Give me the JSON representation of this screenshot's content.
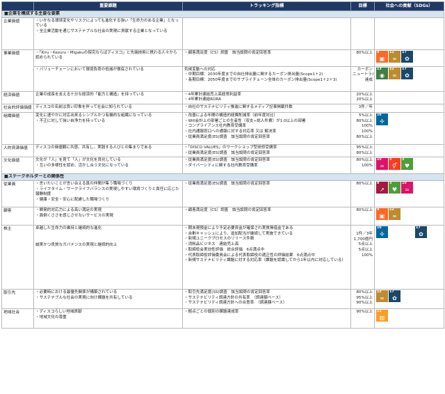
{
  "header": {
    "col_issue": "重要課題",
    "col_tracking": "トラッキング指標",
    "col_target": "目標",
    "col_sdgs": "社会への貢献（SDGs）"
  },
  "colors": {
    "header_bg": "#1f3864",
    "section_bg": "#d6e4f0"
  },
  "sdg_colors": {
    "3": "#4c9f38",
    "5": "#ff3a21",
    "8": "#a21942",
    "9": "#fd6925",
    "10": "#dd1367",
    "11": "#fd9d24",
    "12": "#bf8b2e",
    "13": "#3f7e44",
    "16": "#00689d",
    "17": "#19486a"
  },
  "sdg_icons": {
    "3": "heartbeat-icon",
    "5": "gender-equality-icon",
    "8": "growth-chart-icon",
    "9": "cubes-icon",
    "10": "equality-icon",
    "11": "buildings-icon",
    "12": "infinity-loop-icon",
    "13": "eye-globe-icon",
    "16": "dove-icon",
    "17": "flower-rings-icon"
  },
  "sections": [
    {
      "title": "■企業を構成する主要な要素",
      "rows": [
        {
          "cat": "企業価値",
          "issue": [
            "・いかなる環境変化やリスクによっても進化する強い「生命力のある企業」となっている",
            "・全企業活動を通じサステナブルな社会の実現に貢献する企業となっている"
          ],
          "track": [],
          "tgt": [],
          "sdgs": []
        },
        {
          "cat": "事業価値",
          "issue": [
            "・「Kiru・Kezuru・Migakuの探究ならばディスコ」と先端技術に携わる人々から認められている"
          ],
          "track": [
            "・顧客満足度（CS）調査　該当設問の肯定回答率"
          ],
          "tgt": [
            "80%以上"
          ],
          "sdgs": [
            "9",
            "12",
            "17"
          ]
        },
        {
          "cat": "",
          "issue": [
            "・バリューチェーンにおいて環境負荷の低減が徹底されている"
          ],
          "track": [
            "気候変動への対応",
            "・中期目標：2030年度までの自社排出量に関するカーボン排出量(Scope1＋2)",
            "・長期目標：2050年度までのサプライチェーン全体のカーボン排出量(Scope1＋2＋3)"
          ],
          "tgt": [
            "カーボン",
            "ニュートラル",
            "達成"
          ],
          "sdgs": [
            "13",
            "12",
            "17"
          ]
        },
        {
          "cat": "経済価値",
          "issue": [
            "企業の成長を支える十分な経済的「能力と構造」を持っている"
          ],
          "track": [
            "・4年累計連結売上高経常利益率",
            "・4年累計連結RORA"
          ],
          "tgt": [
            "20%以上",
            "20%以上"
          ],
          "sdgs": []
        },
        {
          "cat": "社会的評価価値",
          "issue": [
            "ディスコの名前は良い印象を伴って社会に知られている"
          ],
          "track": [
            "・自社のサステナビリティ推進に関するメディア記事掲載件数"
          ],
          "tgt": [
            "3件／年"
          ],
          "sdgs": []
        },
        {
          "cat": "組織価値",
          "issue": [
            "変化に速やかに対応出来るシンプルかつ有機的な組織になっている",
            "・不正に対して強い自浄力を持っている"
          ],
          "track": [
            "・改善による年間の構造的経費削減率（前年度対比）",
            "・Will会計上の部署ごとの生産性（収支÷総人件費）が1.0以上の部署",
            "・コンプライアンス社内教育受講率",
            "・社内通報窓口への通報に対する対応率 又は 解決率",
            "・従業員満足度(ES)調査　該当設問の肯定回答率"
          ],
          "tgt": [
            "5%以上",
            "80%以上",
            "100%",
            "100%",
            "80%以上"
          ],
          "sdgs": [
            "16"
          ]
        },
        {
          "cat": "人的資源価値",
          "issue": [
            "ディスコの価値観に共感、共有し、実践する人びとの集まりである"
          ],
          "track": [
            "・「DISCO VALUES」のワークショップ型研修受講率",
            "・従業員満足度(ES)調査　該当設問の肯定回答率"
          ],
          "tgt": [
            "95%以上",
            "80%以上"
          ],
          "sdgs": []
        },
        {
          "cat": "文化価値",
          "issue": [
            "文化が「人」を育て「人」が文化を良化している",
            "・互いの多様性を認め、活かし合う文化になっている"
          ],
          "track": [
            "・従業員満足度(ES)調査　該当設問の肯定回答率",
            "・ダイバーシティに関する社内教育受講率"
          ],
          "tgt": [
            "80%以上",
            "100%"
          ],
          "sdgs": [
            "10",
            "5",
            "3"
          ]
        }
      ]
    },
    {
      "title": "■ステークホルダーとの関係性",
      "rows": [
        {
          "cat": "従業員",
          "issue": [
            "・言いたいことが言い合える真の仲間が集う職場づくり",
            "・ライフタイム・ワークライフバランスの実現しやすい環境づくりと責任に応じた報酬制度",
            "・健康・安全・安心に配慮した職場づくり"
          ],
          "track": [
            "・従業員満足度(ES)調査　該当設問の肯定回答率"
          ],
          "tgt": [
            "80%以上"
          ],
          "sdgs": [
            "8",
            "3",
            "10"
          ]
        },
        {
          "cat": "顧客",
          "issue": [
            "・瞬発的対応力による高い満足の実現",
            "・面倒くささを感じさせないサービスの実現"
          ],
          "track": [
            "・顧客満足度（CS）調査　該当設問の肯定回答率"
          ],
          "tgt": [
            "80%以上"
          ],
          "sdgs": [
            "9",
            "12"
          ]
        },
        {
          "cat": "株主",
          "issue": [
            "卓越した生命力の維持と継続的な進化",
            "",
            "",
            "",
            "",
            "誠実かつ良質なガバナンスの実現と継続的向上"
          ],
          "track": [
            "・期末現預金により予定必要資金が確保され実質無借金である",
            "・余剰キャッシュにより、追加配当が継続して実施できている",
            "・新規ユニークプロセスのリリース件数",
            "・消耗品ビジネス　連結売上高",
            "・取締役会実効性評価　総合評価　6点満点中",
            "・代表取締役評価委員会による代表取締役の適正性の評価結果　6点満点中",
            "・新規サステナビリティ課題に対する対応率（課題を認識してから1年以内に対応している）"
          ],
          "tgt": [
            "",
            "",
            "1件／3年",
            "1,700億円",
            "5点以上",
            "5点以上",
            "100%"
          ],
          "sdgs": [
            "16"
          ],
          "sdgs_extra": [
            "17"
          ]
        },
        {
          "cat": "取引先",
          "issue": [
            "・必要時における最優先関係が構築されている",
            "・サステナブルな社会の実現に向け課題を共有している"
          ],
          "track": [
            "・取引先満足度(SS)調査　該当設問の肯定回答率",
            "・サステナビリティ調達方針の共有率　（調達額ベース）",
            "・サステナビリティ調達方針への合意率　（調達額ベース）"
          ],
          "tgt": [
            "80%以上",
            "95%以上",
            "90%以上"
          ],
          "sdgs": [
            "12",
            "17"
          ]
        },
        {
          "cat": "地域社会",
          "issue": [
            "・ディスコらしい地域貢献",
            "・地域文化の尊重"
          ],
          "track": [
            "・拠点ごとの個別の課題達成率"
          ],
          "tgt": [
            "90%以上"
          ],
          "sdgs": [
            "11"
          ]
        }
      ]
    }
  ]
}
